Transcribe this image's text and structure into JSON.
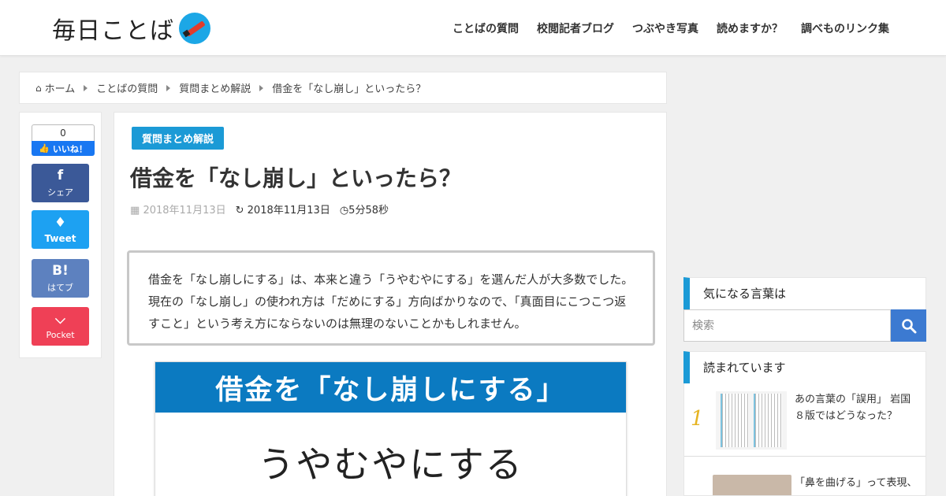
{
  "header": {
    "logo_text": "毎日ことば",
    "nav": [
      "ことばの質問",
      "校閲記者ブログ",
      "つぶやき写真",
      "読めますか？",
      "調べものリンク集"
    ]
  },
  "breadcrumb": {
    "home": "ホーム",
    "items": [
      "ことばの質問",
      "質問まとめ解説",
      "借金を「なし崩し」といったら？"
    ]
  },
  "share": {
    "like_count": "0",
    "like_label": "いいね！",
    "facebook": "シェア",
    "twitter": "Tweet",
    "hatena_icon": "B!",
    "hatena": "はてブ",
    "pocket": "Pocket"
  },
  "article": {
    "category": "質問まとめ解説",
    "title": "借金を「なし崩し」といったら？",
    "published": "2018年11月13日",
    "updated": "2018年11月13日",
    "read_time": "5分58秒",
    "summary": "借金を「なし崩しにする」は、本来と違う「うやむやにする」を選んだ人が大多数でした。現在の「なし崩し」の使われ方は「だめにする」方向ばかりなので、「真面目にこつこつ返すこと」という考え方にならないのは無理のないことかもしれません。",
    "eyecatch_heading": "借金を「なし崩しにする」",
    "eyecatch_body": "うやむやにする"
  },
  "sidebar": {
    "widget1_title": "気になる言葉は",
    "search_placeholder": "検索",
    "widget2_title": "読まれています",
    "ranking": [
      {
        "rank": "1",
        "title": "あの言葉の「誤用」 岩国８版ではどうなった？"
      },
      {
        "rank": "",
        "title": "「鼻を曲げる」って表現、"
      }
    ]
  },
  "colors": {
    "accent": "#1b9ad6",
    "facebook": "#3b5998",
    "twitter": "#1da1f2",
    "hatena": "#5d81bf",
    "pocket": "#ef4056",
    "search_button": "#3c7ad1",
    "rank_gold": "#e6b422"
  }
}
